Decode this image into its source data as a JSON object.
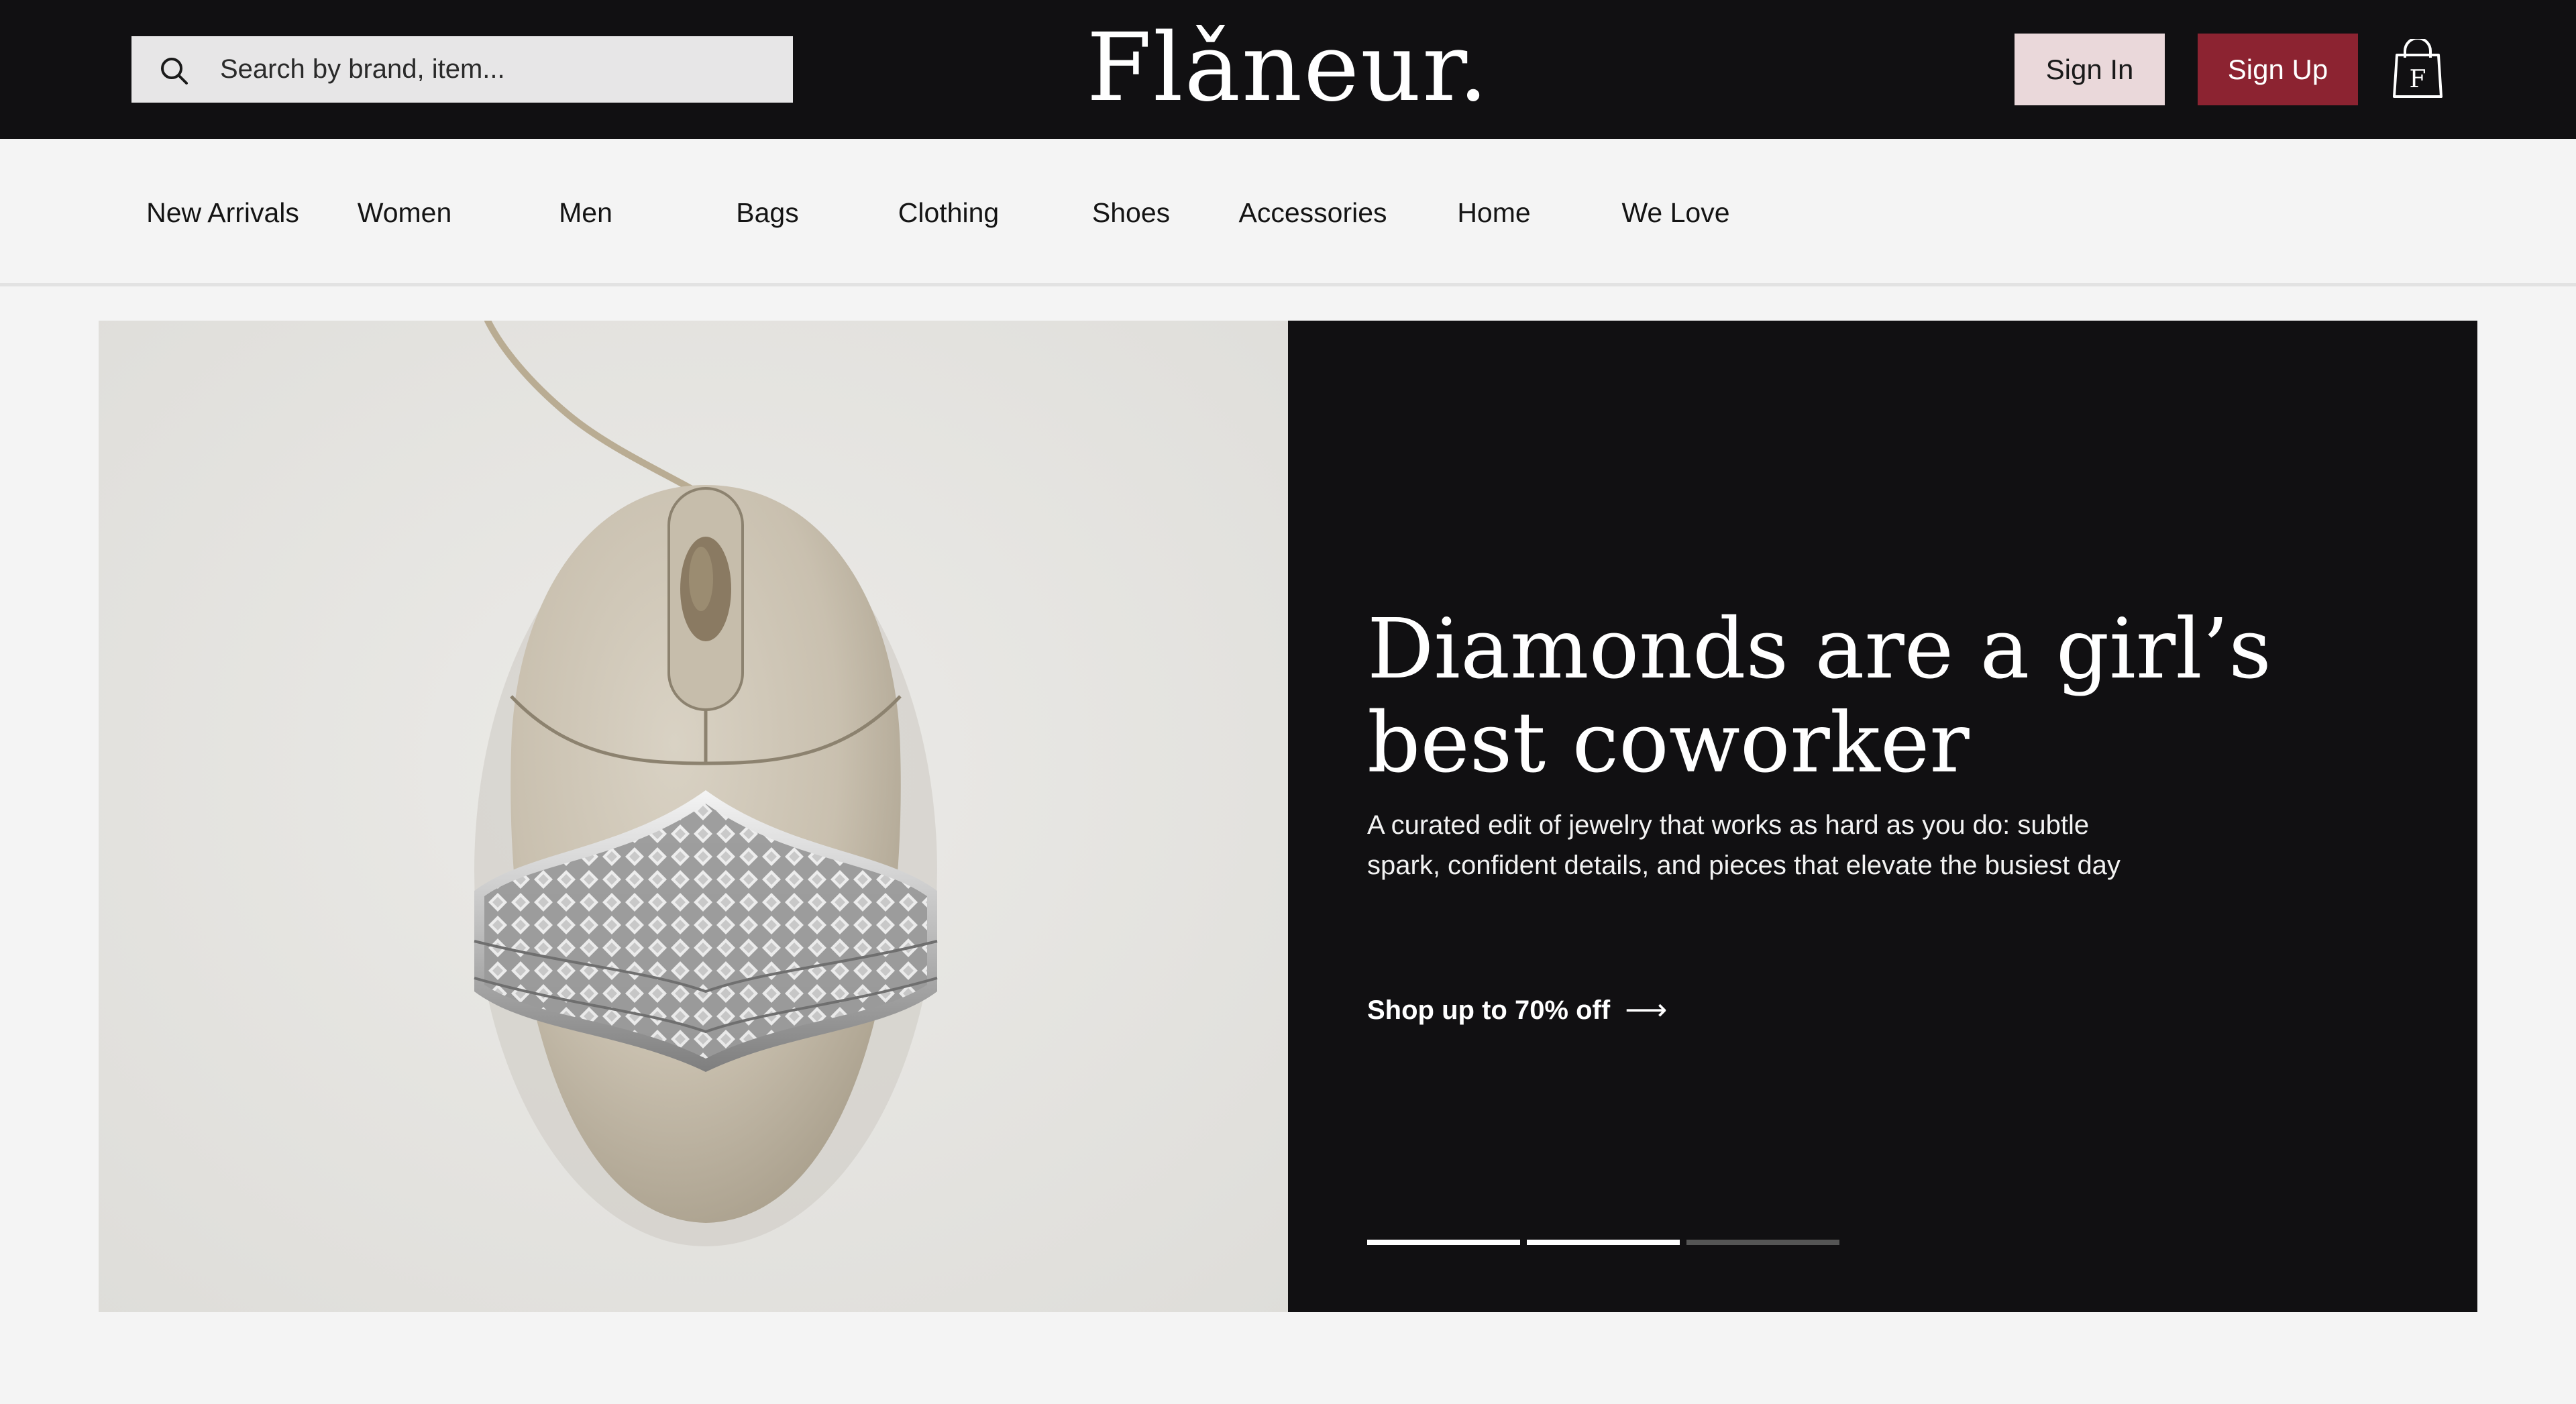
{
  "header": {
    "search_placeholder": "Search by brand, item...",
    "logo": "Flǎneur.",
    "signin_label": "Sign In",
    "signup_label": "Sign Up",
    "cart_letter": "F",
    "icons": {
      "search": "search-icon",
      "cart": "shopping-bag-icon"
    }
  },
  "nav": {
    "items": [
      {
        "label": "New Arrivals"
      },
      {
        "label": "Women"
      },
      {
        "label": "Men"
      },
      {
        "label": "Bags"
      },
      {
        "label": "Clothing"
      },
      {
        "label": "Shoes"
      },
      {
        "label": "Accessories"
      },
      {
        "label": "Home"
      },
      {
        "label": "We Love"
      }
    ]
  },
  "hero": {
    "title": "Diamonds are a girl’s best coworker",
    "description": "A curated edit of jewelry that works as hard as you do: subtle spark, confident details, and pieces that elevate the busiest day",
    "cta_label": "Shop up to 70% off",
    "cta_arrow": "⟶",
    "slides": [
      {
        "active": true
      },
      {
        "active": true
      },
      {
        "active": false
      }
    ]
  },
  "colors": {
    "header_bg": "#111012",
    "signin_bg": "#ead8da",
    "signup_bg": "#8c2331",
    "nav_bg": "#f4f4f4",
    "panel_bg": "#111012",
    "dot_active": "#ffffff",
    "dot_inactive": "#555555"
  }
}
